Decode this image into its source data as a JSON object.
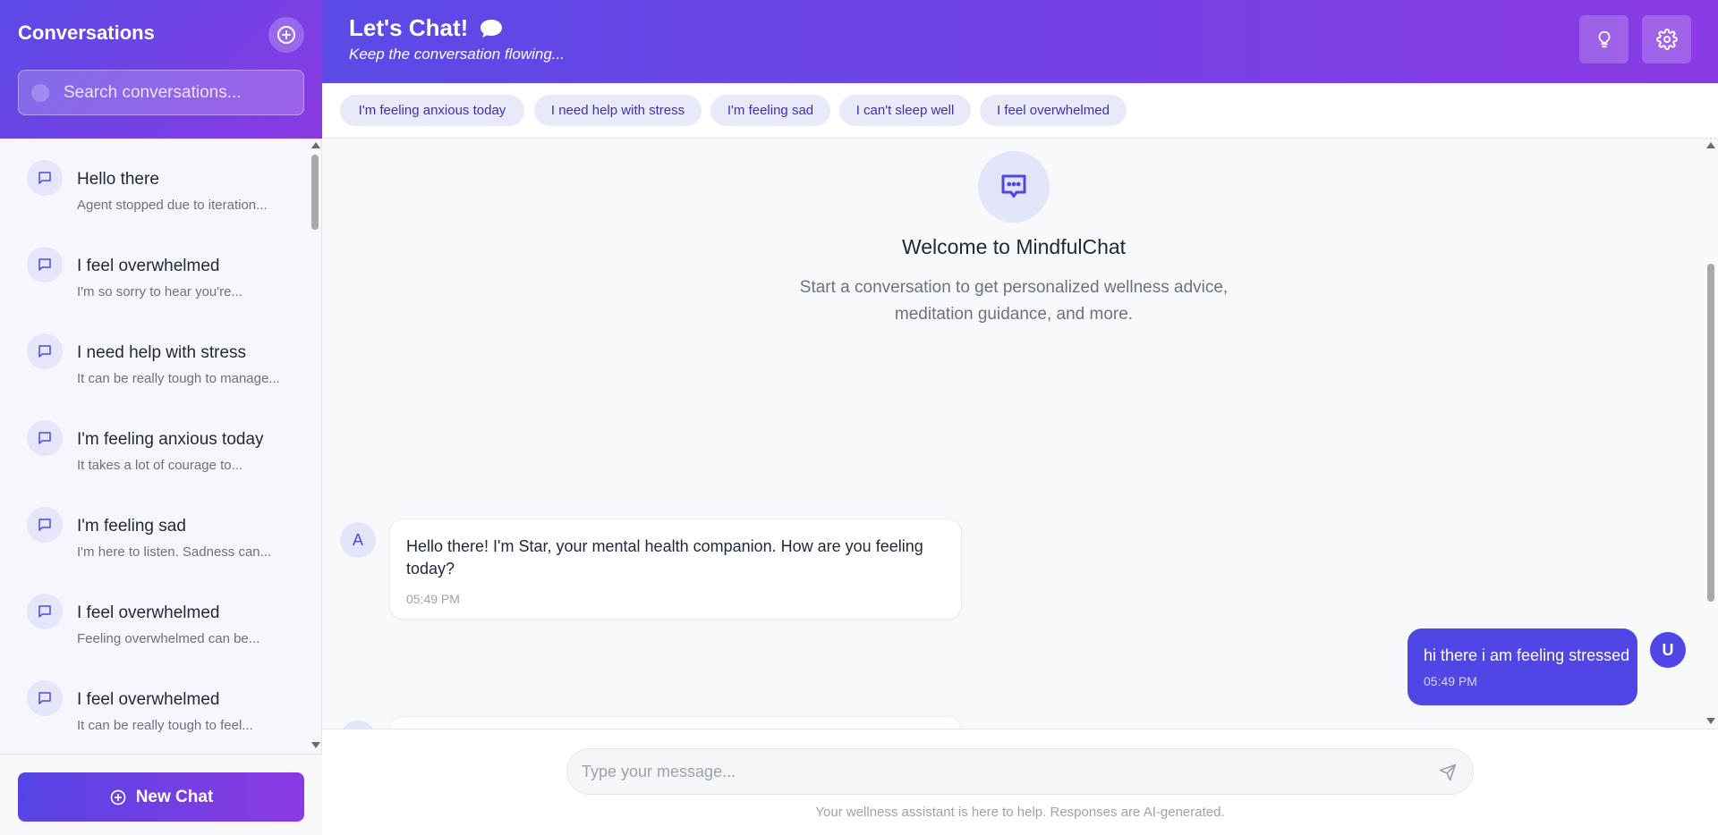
{
  "sidebar": {
    "title": "Conversations",
    "search_placeholder": "Search conversations...",
    "new_chat_label": "New Chat",
    "conversations": [
      {
        "title": "Hello there",
        "preview": "Agent stopped due to iteration..."
      },
      {
        "title": "I feel overwhelmed",
        "preview": "I'm so sorry to hear you're..."
      },
      {
        "title": "I need help with stress",
        "preview": "It can be really tough to manage..."
      },
      {
        "title": "I'm feeling anxious today",
        "preview": "It takes a lot of courage to..."
      },
      {
        "title": "I'm feeling sad",
        "preview": "I'm here to listen. Sadness can..."
      },
      {
        "title": "I feel overwhelmed",
        "preview": "Feeling overwhelmed can be..."
      },
      {
        "title": "I feel overwhelmed",
        "preview": "It can be really tough to feel..."
      }
    ]
  },
  "header": {
    "title": "Let's Chat!",
    "subtitle": "Keep the conversation flowing...",
    "icons": [
      "chat-bubble-icon",
      "lightbulb-icon",
      "gear-icon"
    ]
  },
  "suggestions": [
    "I'm feeling anxious today",
    "I need help with stress",
    "I'm feeling sad",
    "I can't sleep well",
    "I feel overwhelmed"
  ],
  "welcome": {
    "title": "Welcome to MindfulChat",
    "text": "Start a conversation to get personalized wellness advice, meditation guidance, and more."
  },
  "messages": [
    {
      "role": "assistant",
      "avatar": "A",
      "text": "Hello there! I'm Star, your mental health companion. How are you feeling today?",
      "time": "05:49 PM"
    },
    {
      "role": "user",
      "avatar": "U",
      "text": "hi there i am feeling stressed",
      "time": "05:49 PM"
    }
  ],
  "composer": {
    "placeholder": "Type your message...",
    "disclaimer": "Your wellness assistant is here to help. Responses are AI-generated."
  },
  "colors": {
    "accent": "#4f46e5",
    "gradient_start": "#5b4ae6",
    "gradient_end": "#8a3ae3",
    "chip_bg": "#e9eaf9",
    "chip_text": "#3d33a8"
  }
}
